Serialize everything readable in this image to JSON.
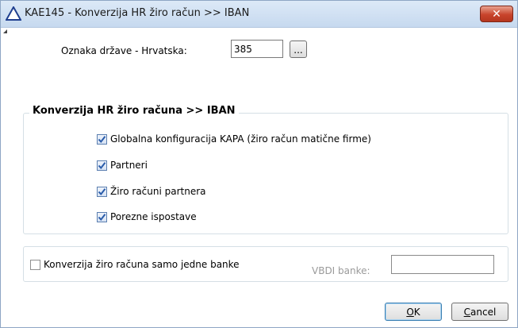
{
  "window": {
    "title": "KAE145 - Konverzija HR žiro račun >> IBAN",
    "close_glyph": "✕"
  },
  "country": {
    "label": "Oznaka države - Hrvatska:",
    "value": "385",
    "lookup_label": "..."
  },
  "group": {
    "legend": "Konverzija HR žiro računa >> IBAN",
    "items": [
      {
        "label": "Globalna konfiguracija KAPA (žiro račun matične firme)",
        "checked": true
      },
      {
        "label": "Partneri",
        "checked": true
      },
      {
        "label": "Žiro računi partnera",
        "checked": true
      },
      {
        "label": "Porezne ispostave",
        "checked": true
      }
    ]
  },
  "single_bank": {
    "label": "Konverzija žiro računa samo jedne banke",
    "checked": false,
    "vbdi_label": "VBDI banke:",
    "vbdi_value": ""
  },
  "buttons": {
    "ok_mnemonic": "O",
    "ok_rest": "K",
    "cancel_mnemonic": "C",
    "cancel_rest": "ancel"
  },
  "icons": {
    "app_icon": "warning-triangle-icon",
    "check_icon": "check-icon"
  },
  "colors": {
    "check_mark": "#2a5caa",
    "titlebar": "#c6d9ef",
    "close_button": "#c8442b"
  }
}
